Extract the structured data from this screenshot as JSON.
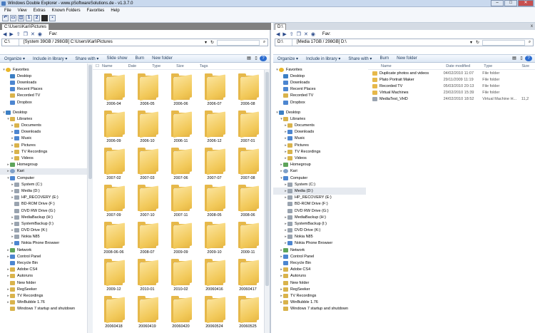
{
  "window": {
    "title": "Windows Double Explorer - www.pSoftwareSolutions.de - v1.3.7.0",
    "controls": [
      "minimize",
      "maximize",
      "close"
    ]
  },
  "menubar": [
    "File",
    "View",
    "Extras",
    "Known Folders",
    "Favorites",
    "Help"
  ],
  "toolbar": {
    "buttons": [
      "undo-icon",
      "layout-single-icon",
      "layout-split-icon",
      "pane-1-icon",
      "pane-2-icon",
      "console-icon",
      "save-icon"
    ],
    "pane1_label": "1",
    "pane2_label": "2"
  },
  "left": {
    "tab": "C:\\Users\\Kari\\Pictures",
    "fav_label": "Fav:",
    "drive": "C:\\",
    "path": "[System 39GB / 298GB] C:\\Users\\Kari\\Pictures",
    "cmd": [
      "Organize ▾",
      "Include in library ▾",
      "Share with ▾",
      "Slide show",
      "Burn",
      "New folder"
    ],
    "columns": [
      "Name",
      "Date",
      "Type",
      "Size",
      "Tags"
    ],
    "tiles": [
      "2006-04",
      "2006-05",
      "2006-06",
      "2006-07",
      "2006-08",
      "2006-09",
      "2006-10",
      "2006-11",
      "2006-12",
      "2007-01",
      "2007-02",
      "2007-03",
      "2007-06",
      "2007-07",
      "2007-08",
      "2007-09",
      "2007-10",
      "2007-11",
      "2008-05",
      "2008-06",
      "2008-06-06",
      "2008-07",
      "2009-09",
      "2009-10",
      "2009-11",
      "2009-12",
      "2010-01",
      "2010-02",
      "20060416",
      "20060417",
      "20060418",
      "20060419",
      "20060420",
      "20060524",
      "20060525"
    ]
  },
  "right": {
    "tab": "D:\\",
    "tab_close": "x",
    "fav_label": "Fav:",
    "drive": "D:\\",
    "path": "[Media 17GB / 298GB] D:\\",
    "cmd": [
      "Organize ▾",
      "Include in library ▾",
      "Share with ▾",
      "Burn",
      "New folder"
    ],
    "columns": [
      "Name",
      "Date modified",
      "Type",
      "Size"
    ],
    "rows": [
      {
        "name": "Duplicate photos and videos",
        "date": "04/02/2010 11:07",
        "type": "File folder",
        "size": "",
        "icon": "folder"
      },
      {
        "name": "Plato Portrait Maker",
        "date": "29/11/2009 11:19",
        "type": "File folder",
        "size": "",
        "icon": "folder"
      },
      {
        "name": "Recorded TV",
        "date": "05/03/2010 20:13",
        "type": "File folder",
        "size": "",
        "icon": "folder"
      },
      {
        "name": "Virtual Machines",
        "date": "23/02/2010 15:39",
        "type": "File folder",
        "size": "",
        "icon": "folder"
      },
      {
        "name": "MediaTest_VHD",
        "date": "24/02/2010 18:52",
        "type": "Virtual Machine H...",
        "size": "11,2",
        "icon": "vhd"
      }
    ]
  },
  "nav": [
    {
      "label": "Favorites",
      "icon": "star",
      "arrow": "▾",
      "indent": 0
    },
    {
      "label": "Desktop",
      "icon": "desktop",
      "arrow": "",
      "indent": 1
    },
    {
      "label": "Downloads",
      "icon": "blue",
      "arrow": "",
      "indent": 1
    },
    {
      "label": "Recent Places",
      "icon": "blue",
      "arrow": "",
      "indent": 1
    },
    {
      "label": "Recorded TV",
      "icon": "lib",
      "arrow": "",
      "indent": 1
    },
    {
      "label": "Dropbox",
      "icon": "blue",
      "arrow": "",
      "indent": 1
    },
    {
      "label": "",
      "spacer": true
    },
    {
      "label": "Desktop",
      "icon": "desktop",
      "arrow": "▾",
      "indent": 0
    },
    {
      "label": "Libraries",
      "icon": "lib",
      "arrow": "▾",
      "indent": 1
    },
    {
      "label": "Documents",
      "icon": "lib",
      "arrow": "▸",
      "indent": 2
    },
    {
      "label": "Downloads",
      "icon": "blue",
      "arrow": "▸",
      "indent": 2
    },
    {
      "label": "Music",
      "icon": "blue",
      "arrow": "▸",
      "indent": 2
    },
    {
      "label": "Pictures",
      "icon": "lib",
      "arrow": "▸",
      "indent": 2
    },
    {
      "label": "TV Recordings",
      "icon": "lib",
      "arrow": "▸",
      "indent": 2
    },
    {
      "label": "Videos",
      "icon": "lib",
      "arrow": "▸",
      "indent": 2
    },
    {
      "label": "Homegroup",
      "icon": "green",
      "arrow": "▸",
      "indent": 1
    },
    {
      "label": "Kari",
      "icon": "user",
      "arrow": "▸",
      "indent": 1,
      "selected_left": true
    },
    {
      "label": "Computer",
      "icon": "blue",
      "arrow": "▾",
      "indent": 1
    },
    {
      "label": "System (C:)",
      "icon": "drive",
      "arrow": "▸",
      "indent": 2
    },
    {
      "label": "Media (D:)",
      "icon": "drive",
      "arrow": "▸",
      "indent": 2,
      "selected_right": true
    },
    {
      "label": "HP_RECOVERY (E:)",
      "icon": "drive",
      "arrow": "▸",
      "indent": 2
    },
    {
      "label": "BD-ROM Drive (F:)",
      "icon": "drive",
      "arrow": "",
      "indent": 2
    },
    {
      "label": "DVD RW Drive (G:)",
      "icon": "drive",
      "arrow": "",
      "indent": 2
    },
    {
      "label": "MediaBackup (H:)",
      "icon": "drive",
      "arrow": "▸",
      "indent": 2
    },
    {
      "label": "SystemBackup (I:)",
      "icon": "drive",
      "arrow": "▸",
      "indent": 2
    },
    {
      "label": "DVD Drive (K:)",
      "icon": "drive",
      "arrow": "▸",
      "indent": 2
    },
    {
      "label": "Nokia N85",
      "icon": "drive",
      "arrow": "▸",
      "indent": 2
    },
    {
      "label": "Nokia Phone Browser",
      "icon": "blue",
      "arrow": "▸",
      "indent": 2
    },
    {
      "label": "Network",
      "icon": "green",
      "arrow": "▸",
      "indent": 1
    },
    {
      "label": "Control Panel",
      "icon": "blue",
      "arrow": "▸",
      "indent": 1
    },
    {
      "label": "Recycle Bin",
      "icon": "blue",
      "arrow": "",
      "indent": 1
    },
    {
      "label": "Adobe CS4",
      "icon": "lib",
      "arrow": "▸",
      "indent": 1
    },
    {
      "label": "Autoruns",
      "icon": "lib",
      "arrow": "▸",
      "indent": 1
    },
    {
      "label": "New folder",
      "icon": "lib",
      "arrow": "",
      "indent": 1
    },
    {
      "label": "RegSeeker",
      "icon": "lib",
      "arrow": "▸",
      "indent": 1
    },
    {
      "label": "TV Recordings",
      "icon": "lib",
      "arrow": "▸",
      "indent": 1
    },
    {
      "label": "WinBubble 1.76",
      "icon": "lib",
      "arrow": "▸",
      "indent": 1
    },
    {
      "label": "Windows 7 startup and shutdown",
      "icon": "lib",
      "arrow": "",
      "indent": 1
    }
  ],
  "photo_tiles": [
    "2008-06",
    "2008-06-06",
    "2008-07",
    "2009-09",
    "2009-10",
    "2009-11",
    "2009-12",
    "2010-01",
    "2010-02",
    "20060416",
    "20060417",
    "20060418",
    "20060419",
    "20060420",
    "20060524",
    "20060525"
  ],
  "colors": {
    "accent": "#2c6ccf",
    "folder": "#f2c95a",
    "titlebar": "#c9d9ee"
  }
}
